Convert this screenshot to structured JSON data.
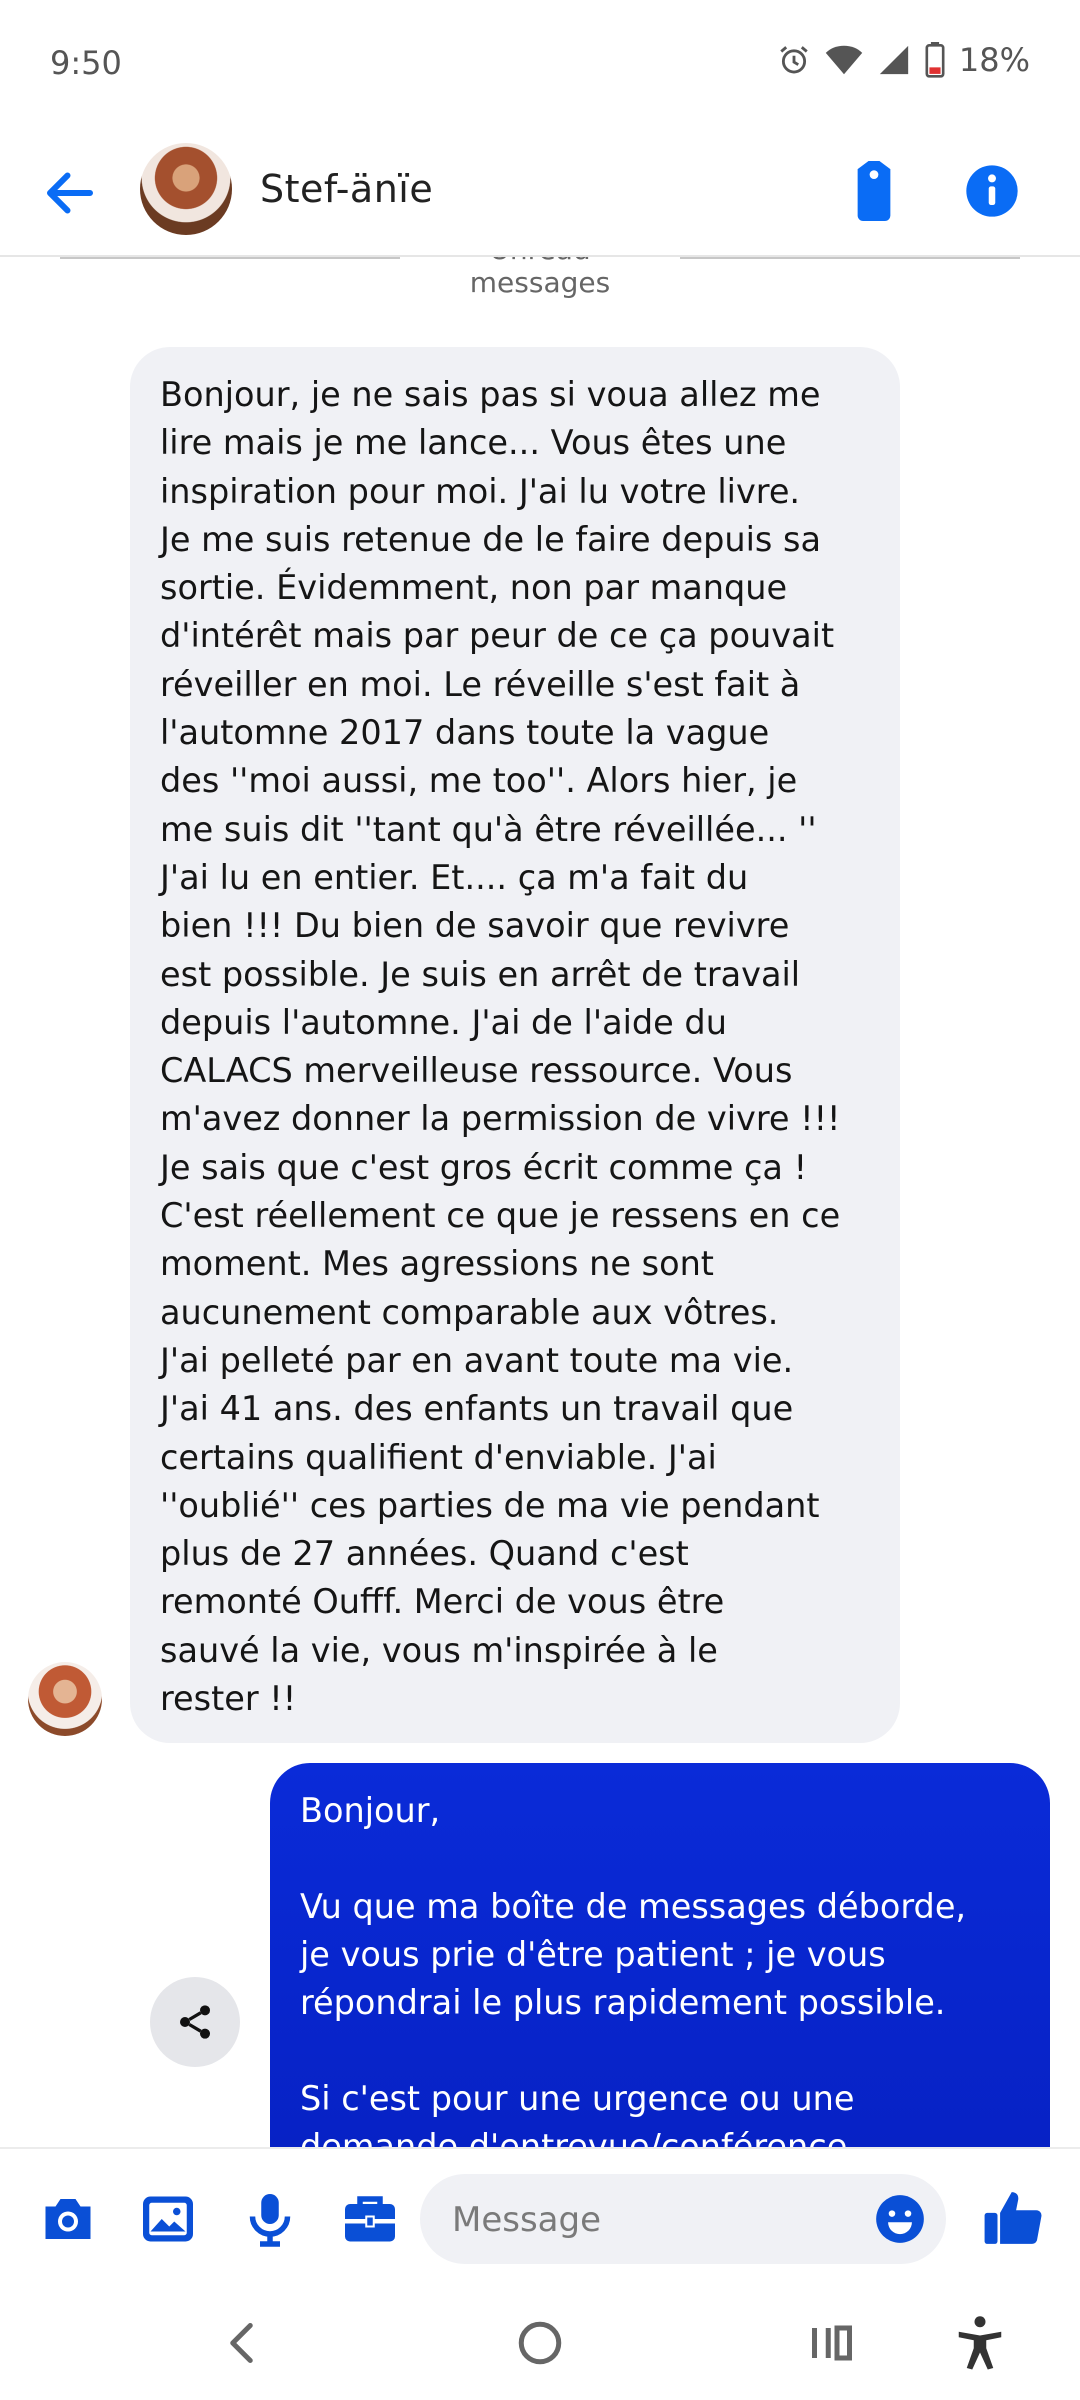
{
  "status_bar": {
    "time": "9:50",
    "battery_text": "18%",
    "icons": [
      "alarm-icon",
      "wifi-icon",
      "signal-icon",
      "battery-icon"
    ]
  },
  "header": {
    "contact_name": "Stef-änïe",
    "icons": [
      "back-arrow-icon",
      "tag-icon",
      "info-icon"
    ]
  },
  "conversation": {
    "unread_label": "Unread messages",
    "incoming": {
      "text": "Bonjour, je ne sais pas si voua allez me\nlire mais je me lance... Vous êtes une\ninspiration pour moi.  J'ai lu votre livre.\nJe me suis retenue de le faire depuis sa\nsortie.  Évidemment, non par manque\nd'intérêt mais par peur de ce ça pouvait\nréveiller en moi.  Le réveille s'est fait à\nl'automne 2017 dans toute la vague\ndes ''moi aussi, me too''.  Alors hier, je\nme suis dit ''tant qu'à être réveillée... ''\nJ'ai lu en entier. Et.... ça m'a fait du\nbien !!! Du bien de savoir que revivre\nest possible.  Je suis en arrêt de travail\ndepuis l'automne.  J'ai de l'aide du\nCALACS merveilleuse ressource. Vous\nm'avez donner la permission de vivre !!!\nJe sais que c'est gros écrit comme ça !\nC'est réellement ce que je ressens en ce\nmoment.  Mes agressions ne sont\naucunement comparable aux vôtres.\nJ'ai pelleté par en avant toute ma vie.\nJ'ai 41 ans. des enfants un travail que\ncertains qualifient d'enviable.  J'ai\n''oublié'' ces parties de ma vie pendant\nplus de 27 années.  Quand c'est\nremonté Oufff.  Merci de vous être\nsauvé la vie, vous m'inspirée à le\nrester !!"
    },
    "outgoing": {
      "text": "Bonjour,\n\nVu que ma boîte de messages déborde,\nje vous prie d'être patient ; je vous\nrépondrai le plus rapidement possible.\n\nSi c'est pour une urgence ou une\ndemande d'entrevue/conférence..."
    }
  },
  "composer": {
    "placeholder": "Message",
    "icons": [
      "camera-icon",
      "image-icon",
      "microphone-icon",
      "briefcase-icon",
      "emoji-icon",
      "thumbs-up-icon"
    ]
  },
  "nav_bar": {
    "icons": [
      "nav-back-icon",
      "home-icon",
      "recents-icon",
      "accessibility-icon"
    ]
  },
  "colors": {
    "accent": "#0a6cf5",
    "outgoing_bubble": "#0722c9",
    "incoming_bubble": "#f0f1f5"
  }
}
